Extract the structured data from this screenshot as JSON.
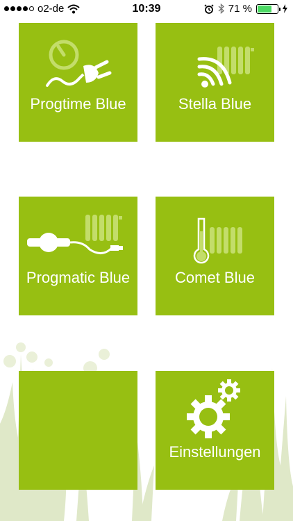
{
  "status_bar": {
    "carrier": "o2-de",
    "time": "10:39",
    "battery_percent": "71 %",
    "battery_level": 0.71,
    "signal_bars_filled": 4,
    "icons": [
      "wifi-icon",
      "alarm-icon",
      "bluetooth-icon",
      "charging-icon"
    ]
  },
  "tiles": [
    {
      "label": "Progtime Blue",
      "icon": "timer-plug-icon"
    },
    {
      "label": "Stella Blue",
      "icon": "wireless-radiator-icon"
    },
    {
      "label": "Progmatic Blue",
      "icon": "cable-radiator-icon"
    },
    {
      "label": "Comet Blue",
      "icon": "thermometer-radiator-icon"
    },
    {
      "label": "",
      "icon": ""
    },
    {
      "label": "Einstellungen",
      "icon": "gears-icon"
    }
  ],
  "colors": {
    "tile": "#97bf12",
    "icon_light": "#c3dd6a",
    "text": "#ffffff",
    "grass": "#dfe8c8"
  }
}
